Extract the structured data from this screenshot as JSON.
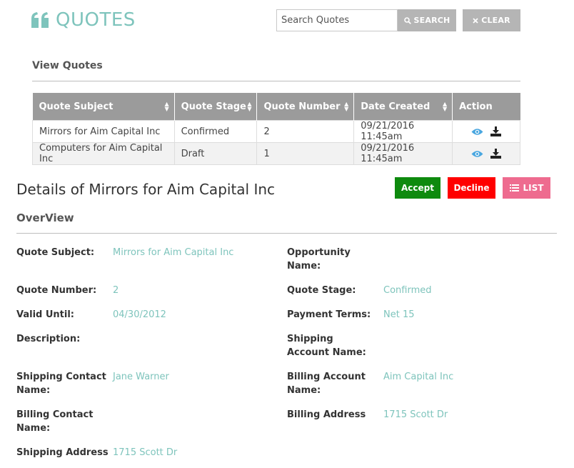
{
  "header": {
    "title": "QUOTES",
    "icon": "quote-marks-icon",
    "accent_color": "#7ec4bc",
    "search_placeholder": "Search Quotes",
    "search_value": "",
    "search_label": "SEARCH",
    "clear_label": "CLEAR"
  },
  "view_quotes": {
    "title": "View Quotes",
    "columns": [
      "Quote Subject",
      "Quote Stage",
      "Quote Number",
      "Date Created",
      "Action"
    ],
    "rows": [
      {
        "subject": "Mirrors for Aim Capital Inc",
        "stage": "Confirmed",
        "number": "2",
        "date": "09/21/2016 11:45am"
      },
      {
        "subject": "Computers for Aim Capital Inc",
        "stage": "Draft",
        "number": "1",
        "date": "09/21/2016 11:45am"
      }
    ]
  },
  "details": {
    "title": "Details of Mirrors for Aim Capital Inc",
    "accept_label": "Accept",
    "decline_label": "Decline",
    "list_label": "LIST",
    "accept_color": "#0e8a0e",
    "decline_color": "#ff0000",
    "list_color": "#ee6b8f",
    "overview_title": "OverView",
    "fields": {
      "quote_subject": {
        "label": "Quote Subject:",
        "value": "Mirrors for Aim Capital Inc"
      },
      "opportunity_name": {
        "label": "Opportunity Name:",
        "value": ""
      },
      "quote_number": {
        "label": "Quote Number:",
        "value": "2"
      },
      "quote_stage": {
        "label": "Quote Stage:",
        "value": "Confirmed"
      },
      "valid_until": {
        "label": "Valid Until:",
        "value": "04/30/2012"
      },
      "payment_terms": {
        "label": "Payment Terms:",
        "value": "Net 15"
      },
      "description": {
        "label": "Description:",
        "value": ""
      },
      "shipping_account_name": {
        "label": "Shipping Account Name:",
        "value": ""
      },
      "shipping_contact_name": {
        "label": "Shipping Contact Name:",
        "value": "Jane Warner"
      },
      "billing_account_name": {
        "label": "Billing Account Name:",
        "value": "Aim Capital Inc"
      },
      "billing_contact_name": {
        "label": "Billing Contact Name:",
        "value": ""
      },
      "billing_address": {
        "label": "Billing Address",
        "value": "1715 Scott Dr"
      },
      "shipping_address": {
        "label": "Shipping Address",
        "value": "1715 Scott Dr"
      }
    }
  }
}
